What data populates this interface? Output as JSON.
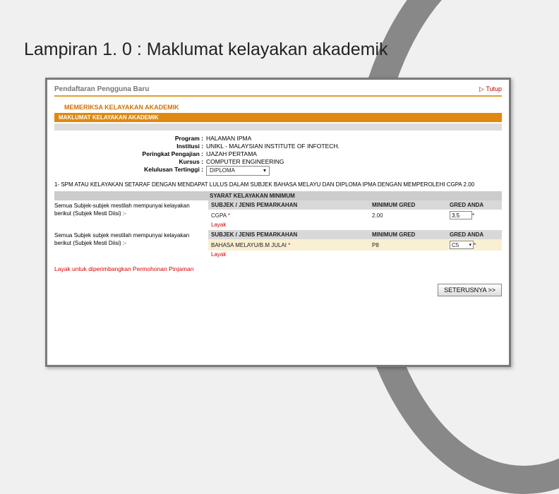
{
  "slide": {
    "title": "Lampiran 1. 0 : Maklumat kelayakan akademik"
  },
  "topbar": {
    "title": "Pendaftaran Pengguna Baru",
    "close": "Tutup"
  },
  "section_h1": "MEMERIKSA KELAYAKAN AKADEMIK",
  "orange_bar": "MAKLUMAT KELAYAKAN AKADEMIK",
  "info": {
    "program_lbl": "Program :",
    "program_val": "HALAMAN IPMA",
    "institusi_lbl": "Institusi :",
    "institusi_val": "UNIKL - MALAYSIAN INSTITUTE OF INFOTECH.",
    "peringkat_lbl": "Peringkat Pengajian :",
    "peringkat_val": "IJAZAH PERTAMA",
    "kursus_lbl": "Kursus :",
    "kursus_val": "COMPUTER ENGINEERING",
    "kelulusan_lbl": "Kelulusan Tertinggi :",
    "kelulusan_val": "DIPLOMA"
  },
  "req_desc": "1- SPM ATAU KELAYAKAN SETARAF DENGAN MENDAPAT LULUS DALAM SUBJEK BAHASA MELAYU DAN DIPLOMA IPMA DENGAN MEMPEROLEHI CGPA 2.00",
  "grey_hdr": "SYARAT KELAYAKAN MINIMUM",
  "row1": {
    "left": "Semua Subjek-subjek mestilah mempunyai kelayakan berikut (Subjek Mesti Diisi) :-",
    "hdr_sub": "SUBJEK / JENIS PEMARKAHAN",
    "hdr_min": "MINIMUM GRED",
    "hdr_gred": "GRED ANDA",
    "subj": "CGPA",
    "min": "2.00",
    "gred": "3.5",
    "layak": "Layak"
  },
  "row2": {
    "left": "Semua Subjek subjek mestilah mempunyai kelayakan berikut (Subjek Mesti Diisi) :-",
    "hdr_sub": "SUBJEK / JENIS PEMARKAHAN",
    "hdr_min": "MINIMUM GRED",
    "hdr_gred": "GRED ANDA",
    "subj": "BAHASA MELAYU/B.M JULAI",
    "min": "P8",
    "gred": "C5",
    "layak": "Layak"
  },
  "final_msg": "Layak untuk diperimbangkan Permohonan Pinjaman",
  "next_btn": "SETERUSNYA >>"
}
